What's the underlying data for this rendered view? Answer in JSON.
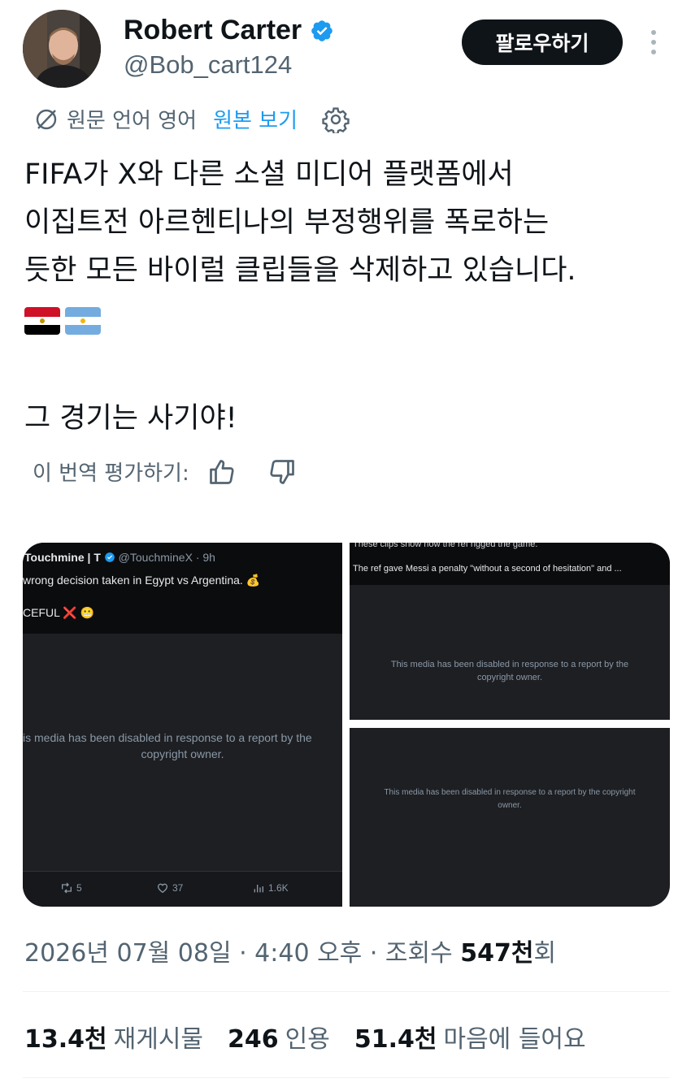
{
  "author": {
    "name": "Robert Carter",
    "handle": "@Bob_cart124",
    "follow_label": "팔로우하기"
  },
  "translation": {
    "source_language": "원문 언어 영어",
    "show_original_label": "원본 보기"
  },
  "tweet": {
    "lines": [
      "FIFA가 X와 다른 소셜 미디어 플랫폼에서",
      "이집트전 아르헨티나의 부정행위를 폭로하는",
      "듯한 모든 바이럴 클립들을 삭제하고 있습니다."
    ],
    "closing": "그 경기는 사기야!"
  },
  "rate_translation_label": "이 번역 평가하기:",
  "media": {
    "left": {
      "user": "Touchmine | T",
      "user_tag": "@TouchmineX · 9h",
      "text": "wrong decision taken in Egypt vs Argentina. 💰",
      "text2": "CEFUL ❌ 😬",
      "disabled_line1": "is media has been disabled in response to a report by the",
      "disabled_line2": "copyright owner.",
      "retweets": "5",
      "likes": "37",
      "views": "1.6K"
    },
    "top_right": {
      "caption": "These clips show how the ref rigged the game.",
      "title": "The ref gave Messi a penalty \"without a second of hesitation\" and ...",
      "disabled_line1": "This media has been disabled in response to a report by the",
      "disabled_line2": "copyright owner."
    },
    "bottom_right": {
      "disabled_line1": "This media has been disabled in response to a report by the copyright",
      "disabled_line2": "owner."
    }
  },
  "meta": {
    "datetime": "2026년 07월 08일 · 4:40 오후 · 조회수 ",
    "views_count": "547천",
    "views_suffix": "회"
  },
  "engagement": {
    "reposts_count": "13.4천",
    "reposts_label": "재게시물",
    "quotes_count": "246",
    "quotes_label": "인용",
    "likes_count": "51.4천",
    "likes_label": "마음에 들어요"
  },
  "colors": {
    "accent": "#1d9bf0",
    "text_primary": "#0f1419",
    "text_secondary": "#536471",
    "media_bg": "#1d1f23"
  }
}
